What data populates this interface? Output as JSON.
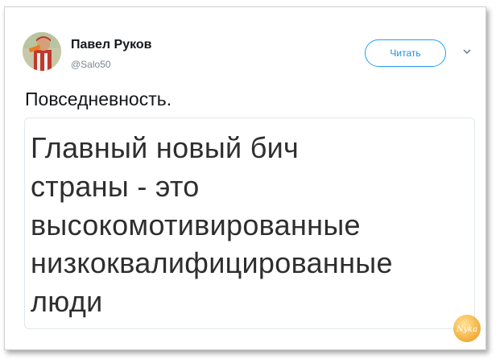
{
  "tweet": {
    "author_name": "Павел Руков",
    "author_handle": "@Salo50",
    "follow_label": "Читать",
    "text": "Повседневность.",
    "card_lines": [
      "Главный новый бич",
      "страны - это",
      "высокомотивированные",
      "низкоквалифицированные",
      "люди"
    ]
  },
  "icons": {
    "avatar": "avatar-photo",
    "menu": "chevron-down-icon",
    "watermark": "site-logo"
  },
  "watermark": {
    "text": "Nyka"
  },
  "colors": {
    "accent": "#1da1f2",
    "text": "#14171a",
    "muted": "#7a8791",
    "card_border": "#e1e8ed"
  }
}
